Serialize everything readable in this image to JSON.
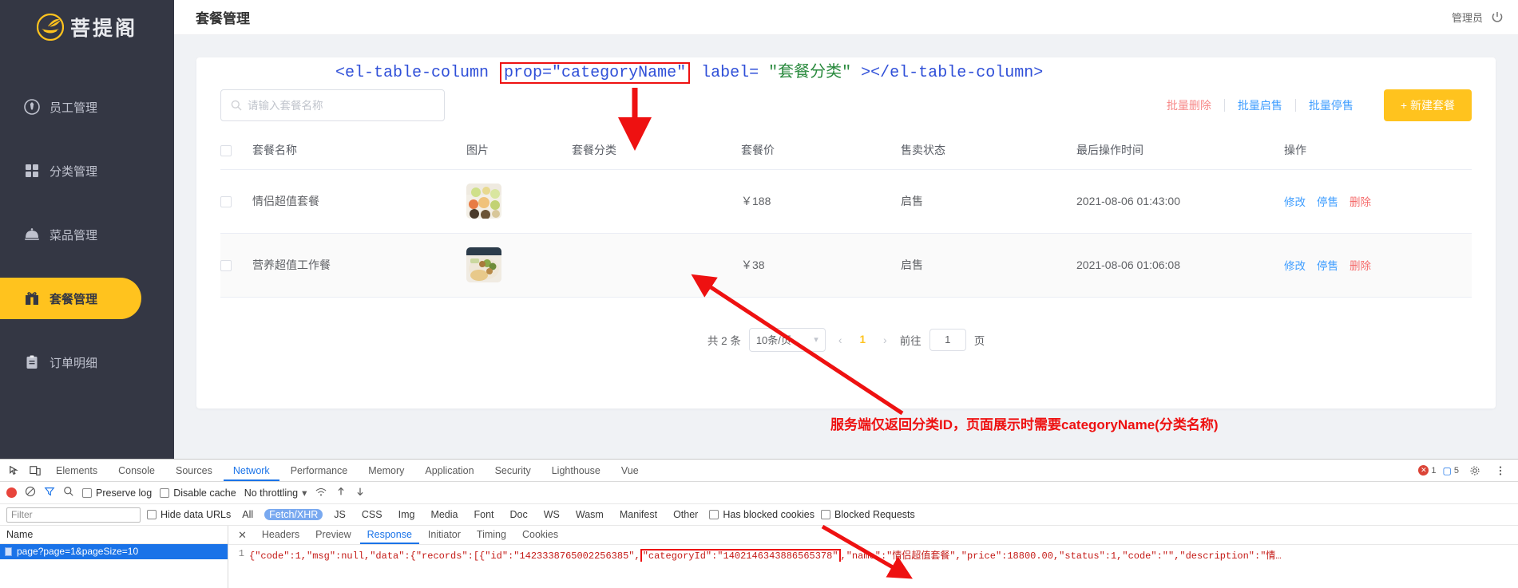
{
  "brand": {
    "name": "菩提阁",
    "logo_icon": "leaf-bowl-logo"
  },
  "sidebar": {
    "items": [
      {
        "label": "员工管理",
        "icon": "employee-tie-icon",
        "active": false
      },
      {
        "label": "分类管理",
        "icon": "grid-squares-icon",
        "active": false
      },
      {
        "label": "菜品管理",
        "icon": "cloche-dish-icon",
        "active": false
      },
      {
        "label": "套餐管理",
        "icon": "gift-box-icon",
        "active": true
      },
      {
        "label": "订单明细",
        "icon": "clipboard-icon",
        "active": false
      }
    ]
  },
  "topbar": {
    "title": "套餐管理",
    "user": "管理员",
    "logout_icon": "power-icon"
  },
  "toolbar": {
    "search_placeholder": "请输入套餐名称",
    "search_value": "",
    "search_icon": "search-icon",
    "batch_delete": "批量删除",
    "batch_enable": "批量启售",
    "batch_disable": "批量停售",
    "new_combo": "+ 新建套餐"
  },
  "table": {
    "columns": [
      "套餐名称",
      "图片",
      "套餐分类",
      "套餐价",
      "售卖状态",
      "最后操作时间",
      "操作"
    ],
    "rows": [
      {
        "name": "情侣超值套餐",
        "image_icon": "combo-meal-photo",
        "category": "",
        "price": "￥188",
        "status": "启售",
        "updated": "2021-08-06 01:43:00",
        "ops": [
          "修改",
          "停售",
          "删除"
        ]
      },
      {
        "name": "营养超值工作餐",
        "image_icon": "worklunch-photo",
        "category": "",
        "price": "￥38",
        "status": "启售",
        "updated": "2021-08-06 01:06:08",
        "ops": [
          "修改",
          "停售",
          "删除"
        ]
      }
    ]
  },
  "pagination": {
    "total_label": "共 2 条",
    "page_size": "10条/页",
    "prev_icon": "chevron-left-icon",
    "next_icon": "chevron-right-icon",
    "current_page": "1",
    "jump_prefix": "前往",
    "jump_value": "1",
    "jump_suffix": "页"
  },
  "annotations": {
    "code": {
      "part1": "<el-table-column ",
      "highlight": "prop=\"categoryName\"",
      "part2": " label=",
      "part3": "\"套餐分类\"",
      "part4": "></el-table-column>"
    },
    "note": "服务端仅返回分类ID，页面展示时需要categoryName(分类名称)",
    "highlight_color": "#ee1111"
  },
  "devtools": {
    "tabs": [
      "Elements",
      "Console",
      "Sources",
      "Network",
      "Performance",
      "Memory",
      "Application",
      "Security",
      "Lighthouse",
      "Vue"
    ],
    "active_tab": "Network",
    "error_count": "1",
    "message_count": "5",
    "inspect_icon": "inspect-cursor-icon",
    "device_icon": "device-toolbar-icon",
    "settings_icon": "gear-icon",
    "more_icon": "kebab-menu-icon",
    "toolbar": {
      "record_icon": "record-dot-icon",
      "clear_icon": "clear-circle-icon",
      "filter_icon": "funnel-icon",
      "search_icon": "search-icon",
      "preserve_log": "Preserve log",
      "disable_cache": "Disable cache",
      "throttling": "No throttling",
      "throttle_caret": "chevron-down-icon",
      "wifi_icon": "wifi-icon",
      "import_icon": "upload-arrow-icon",
      "export_icon": "download-arrow-icon"
    },
    "filter": {
      "placeholder": "Filter",
      "hide_data_urls": "Hide data URLs",
      "types": [
        "All",
        "Fetch/XHR",
        "JS",
        "CSS",
        "Img",
        "Media",
        "Font",
        "Doc",
        "WS",
        "Wasm",
        "Manifest",
        "Other"
      ],
      "active_type": "Fetch/XHR",
      "has_blocked_cookies": "Has blocked cookies",
      "blocked_requests": "Blocked Requests"
    },
    "requests": {
      "header": "Name",
      "items": [
        {
          "name": "page?page=1&pageSize=10",
          "icon": "xhr-doc-icon",
          "selected": true
        }
      ]
    },
    "detail": {
      "close_icon": "close-icon",
      "subtabs": [
        "Headers",
        "Preview",
        "Response",
        "Initiator",
        "Timing",
        "Cookies"
      ],
      "active_subtab": "Response",
      "line_number": "1",
      "json": {
        "pre": "{\"code\":1,\"msg\":null,\"data\":{\"records\":[{\"id\":\"1423338765002256385\",",
        "highlight": "\"categoryId\":\"1402146343886565378\"",
        "post": ",\"name\":\"情侣超值套餐\",\"price\":18800.00,\"status\":1,\"code\":\"\",\"description\":\"情…"
      }
    }
  }
}
